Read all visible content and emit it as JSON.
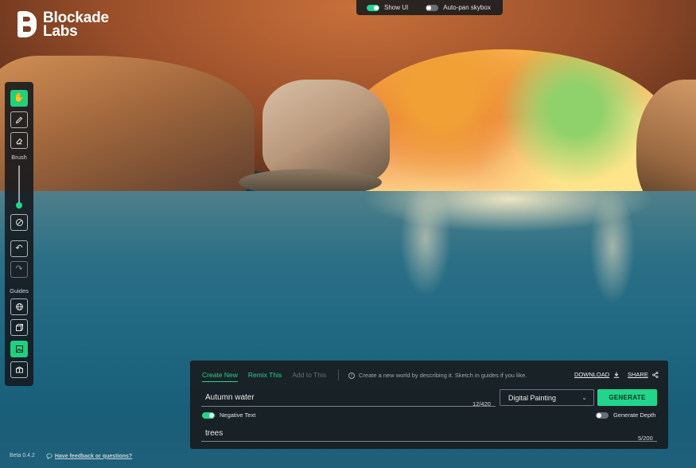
{
  "brand": {
    "name_line1": "Blockade",
    "name_line2": "Labs"
  },
  "topbar": {
    "show_ui": {
      "label": "Show UI",
      "on": true
    },
    "auto_pan": {
      "label": "Auto-pan skybox",
      "on": false
    }
  },
  "tools": {
    "brush_label": "Brush",
    "guides_label": "Guides",
    "items": [
      {
        "icon": "hand-icon",
        "active": true
      },
      {
        "icon": "pencil-icon",
        "active": false
      },
      {
        "icon": "eraser-icon",
        "active": false
      },
      {
        "icon": "clear-icon",
        "active": false
      },
      {
        "icon": "undo-icon",
        "active": false
      },
      {
        "icon": "redo-icon",
        "active": false
      },
      {
        "icon": "globe-icon",
        "active": false
      },
      {
        "icon": "cube-icon",
        "active": false
      },
      {
        "icon": "image-icon",
        "active": true
      },
      {
        "icon": "box-icon",
        "active": false
      }
    ]
  },
  "panel": {
    "tabs": [
      "Create New",
      "Remix This",
      "Add to This"
    ],
    "hint": "Create a new world by describing it. Sketch in guides if you like.",
    "download_label": "DOWNLOAD",
    "share_label": "SHARE",
    "prompt": {
      "value": "Autumn water",
      "count": "12/420"
    },
    "style_select": "Digital Painting",
    "generate_label": "GENERATE",
    "negative_text": {
      "label": "Negative Text",
      "on": true
    },
    "generate_depth": {
      "label": "Generate Depth",
      "on": false
    },
    "negative_prompt": {
      "value": "trees",
      "count": "5/200"
    }
  },
  "footer": {
    "version": "Beta 0.4.2",
    "feedback": "Have feedback or questions?"
  },
  "colors": {
    "accent": "#22d58a",
    "panel_bg": "#181c20"
  }
}
